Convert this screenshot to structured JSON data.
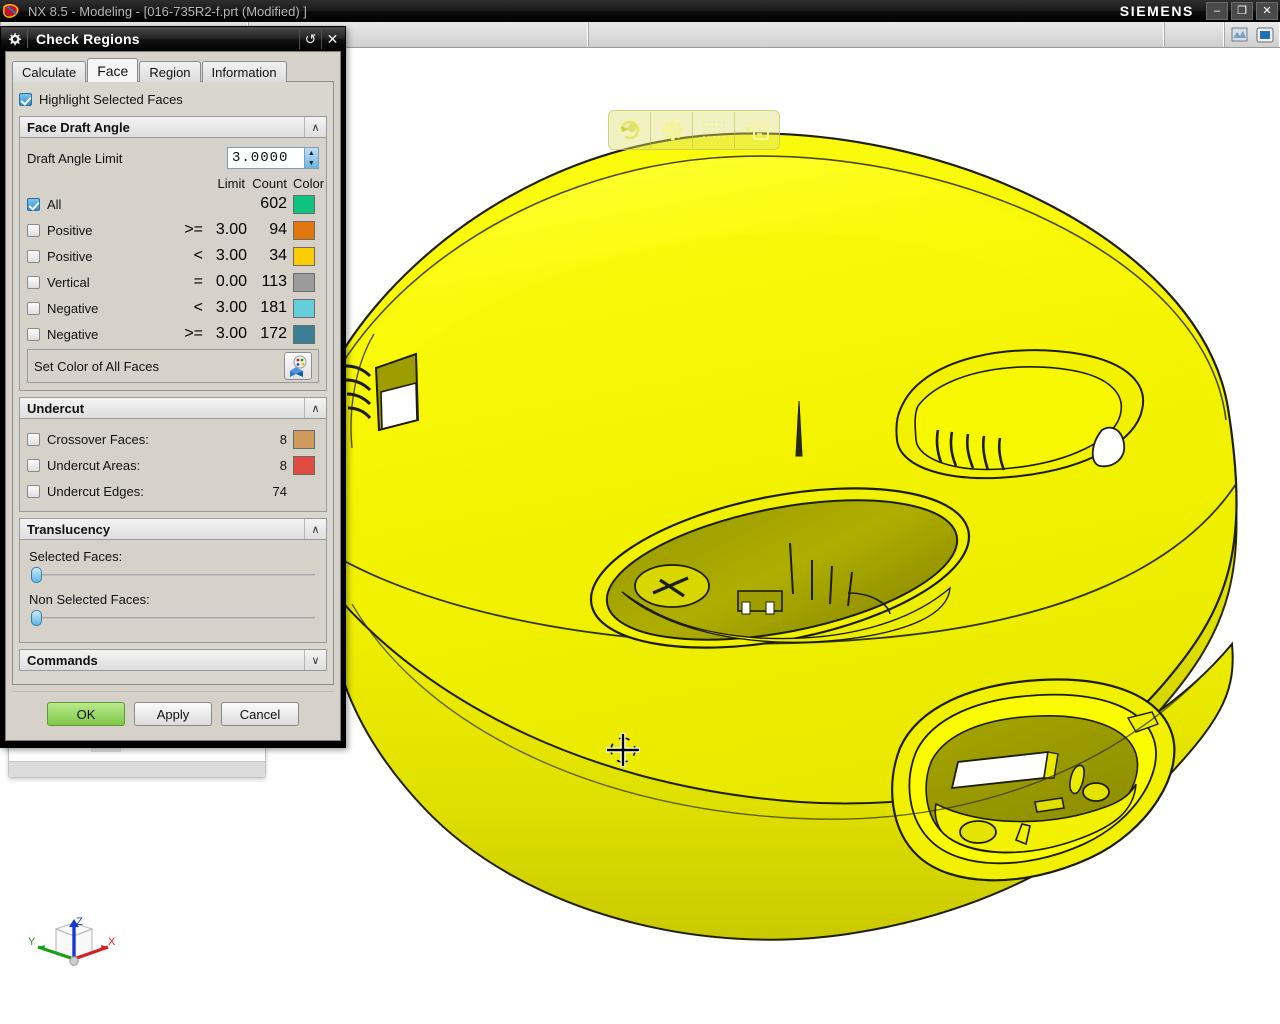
{
  "window": {
    "title": "NX 8.5 - Modeling - [016-735R2-f.prt (Modified) ]",
    "brand": "SIEMENS",
    "app_icon": "nx-logo-icon",
    "minimize_label": "–",
    "restore_label": "❐",
    "close_label": "✕"
  },
  "dialog": {
    "title": "Check Regions",
    "menu_icon": "gear-icon",
    "reset_label": "↺",
    "close_label": "✕",
    "tabs": [
      {
        "label": "Calculate",
        "active": false
      },
      {
        "label": "Face",
        "active": true
      },
      {
        "label": "Region",
        "active": false
      },
      {
        "label": "Information",
        "active": false
      }
    ],
    "highlight": {
      "label": "Highlight Selected Faces",
      "checked": true
    },
    "face_draft_angle": {
      "title": "Face Draft Angle",
      "collapse_icon": "∧",
      "draft_angle_limit_label": "Draft Angle Limit",
      "draft_angle_limit_value": "3.0000",
      "spin_up": "▲",
      "spin_down": "▼",
      "columns": {
        "limit": "Limit",
        "count": "Count",
        "color": "Color"
      },
      "rows": [
        {
          "label": "All",
          "op": "",
          "limit": "",
          "count": "602",
          "color": "#0ec37e",
          "checked": true
        },
        {
          "label": "Positive",
          "op": ">=",
          "limit": "3.00",
          "count": "94",
          "color": "#e2760e",
          "checked": false
        },
        {
          "label": "Positive",
          "op": "<",
          "limit": "3.00",
          "count": "34",
          "color": "#fbcc00",
          "checked": false
        },
        {
          "label": "Vertical",
          "op": "=",
          "limit": "0.00",
          "count": "113",
          "color": "#9b9b9b",
          "checked": false
        },
        {
          "label": "Negative",
          "op": "<",
          "limit": "3.00",
          "count": "181",
          "color": "#66cddb",
          "checked": false
        },
        {
          "label": "Negative",
          "op": ">=",
          "limit": "3.00",
          "count": "172",
          "color": "#3a7f96",
          "checked": false
        }
      ],
      "set_color_label": "Set Color of All Faces",
      "set_color_icon": "color-palette-icon"
    },
    "undercut": {
      "title": "Undercut",
      "collapse_icon": "∧",
      "rows": [
        {
          "label": "Crossover Faces:",
          "count": "8",
          "color": "#cf9a5e",
          "checked": false
        },
        {
          "label": "Undercut Areas:",
          "count": "8",
          "color": "#e04b42",
          "checked": false
        },
        {
          "label": "Undercut Edges:",
          "count": "74",
          "color": "",
          "checked": false
        }
      ]
    },
    "translucency": {
      "title": "Translucency",
      "collapse_icon": "∧",
      "selected_faces_label": "Selected Faces:",
      "selected_faces_value": 0,
      "non_selected_faces_label": "Non Selected Faces:",
      "non_selected_faces_value": 0
    },
    "commands": {
      "title": "Commands",
      "collapse_icon": "∨"
    },
    "buttons": {
      "ok": "OK",
      "apply": "Apply",
      "cancel": "Cancel"
    }
  },
  "viewport": {
    "float_toolbar": [
      {
        "icon": "rotate-refresh-icon"
      },
      {
        "icon": "gear-icon"
      },
      {
        "icon": "dotted-grid-icon"
      },
      {
        "icon": "list-menu-icon"
      }
    ],
    "cursor_icon": "crosshair-cursor-icon",
    "triad": {
      "icon": "wcs-triad-icon",
      "x_label": "X",
      "y_label": "Y",
      "z_label": "Z",
      "x_color": "#d42020",
      "y_color": "#17a017",
      "z_color": "#1838d0"
    },
    "model": {
      "name": "plastic-housing-part",
      "body_color": "#f5f500",
      "shadow_color": "#a8a800",
      "edge_color": "#000000"
    }
  },
  "toolbar_icons": [
    {
      "icon": "render-style-icon"
    },
    {
      "icon": "fit-view-icon"
    }
  ]
}
